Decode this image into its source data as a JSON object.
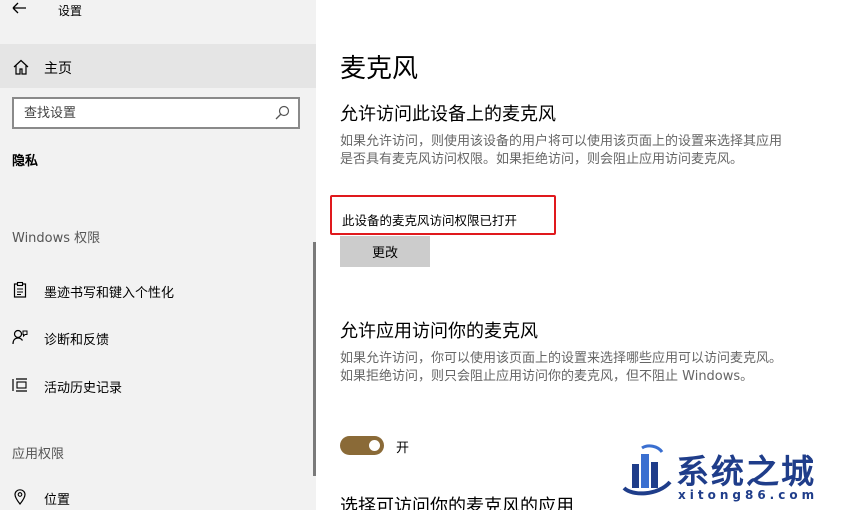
{
  "window": {
    "title": "设置"
  },
  "sidebar": {
    "home_label": "主页",
    "search_placeholder": "查找设置",
    "privacy_heading": "隐私",
    "windows_permissions_label": "Windows 权限",
    "items": [
      {
        "label": "墨迹书写和键入个性化",
        "icon": "clipboard-icon"
      },
      {
        "label": "诊断和反馈",
        "icon": "feedback-icon"
      },
      {
        "label": "活动历史记录",
        "icon": "history-icon"
      }
    ],
    "app_permissions_label": "应用权限",
    "app_items": [
      {
        "label": "位置",
        "icon": "location-icon"
      }
    ]
  },
  "main": {
    "title": "麦克风",
    "section1": {
      "heading": "允许访问此设备上的麦克风",
      "description": "如果允许访问，则使用该设备的用户将可以使用该页面上的设置来选择其应用是否具有麦克风访问权限。如果拒绝访问，则会阻止应用访问麦克风。",
      "status": "此设备的麦克风访问权限已打开",
      "change_button": "更改"
    },
    "section2": {
      "heading": "允许应用访问你的麦克风",
      "description": "如果允许访问，你可以使用该页面上的设置来选择哪些应用可以访问麦克风。如果拒绝访问，则只会阻止应用访问你的麦克风，但不阻止 Windows。",
      "toggle_state": "on",
      "toggle_label": "开"
    },
    "section3": {
      "heading": "选择可访问你的麦克风的应用"
    }
  },
  "colors": {
    "accent": "#8a6a37",
    "highlight": "#e0191d",
    "sidebar_bg": "#f2f2f2",
    "watermark": "#1f3d8a"
  },
  "watermark": {
    "title": "系统之城",
    "url": "xitong86.com"
  }
}
